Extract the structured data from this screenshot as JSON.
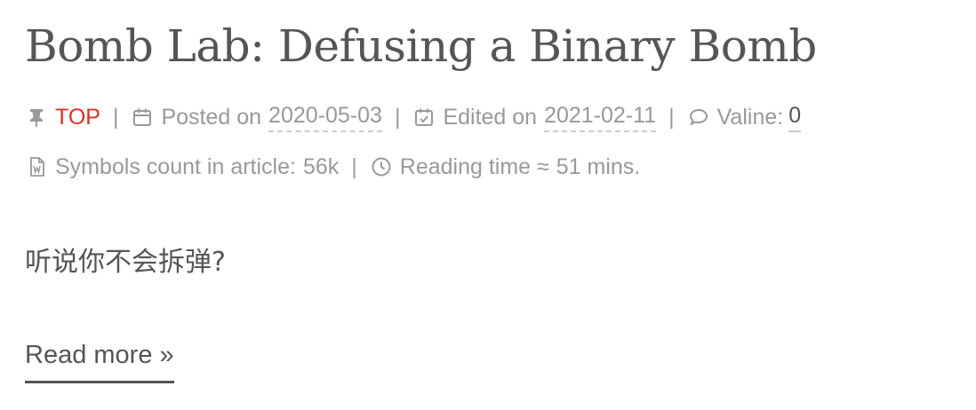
{
  "post": {
    "title": "Bomb Lab: Defusing a Binary Bomb",
    "excerpt": "听说你不会拆弹?",
    "read_more": "Read more »"
  },
  "meta": {
    "top_label": "TOP",
    "separator": "|",
    "posted_label": "Posted on",
    "posted_date": "2020-05-03",
    "edited_label": "Edited on",
    "edited_date": "2021-02-11",
    "comments_label": "Valine:",
    "comments_count": "0",
    "symbols_label": "Symbols count in article:",
    "symbols_count": "56k",
    "reading_label": "Reading time ≈",
    "reading_time": "51 mins."
  },
  "icons": {
    "pin": "thumbtack-icon",
    "posted": "calendar-icon",
    "edited": "calendar-check-icon",
    "comments": "comment-icon",
    "symbols": "file-word-icon",
    "reading": "clock-icon"
  },
  "colors": {
    "top": "#e0301e",
    "text": "#555555",
    "meta": "#999999"
  }
}
